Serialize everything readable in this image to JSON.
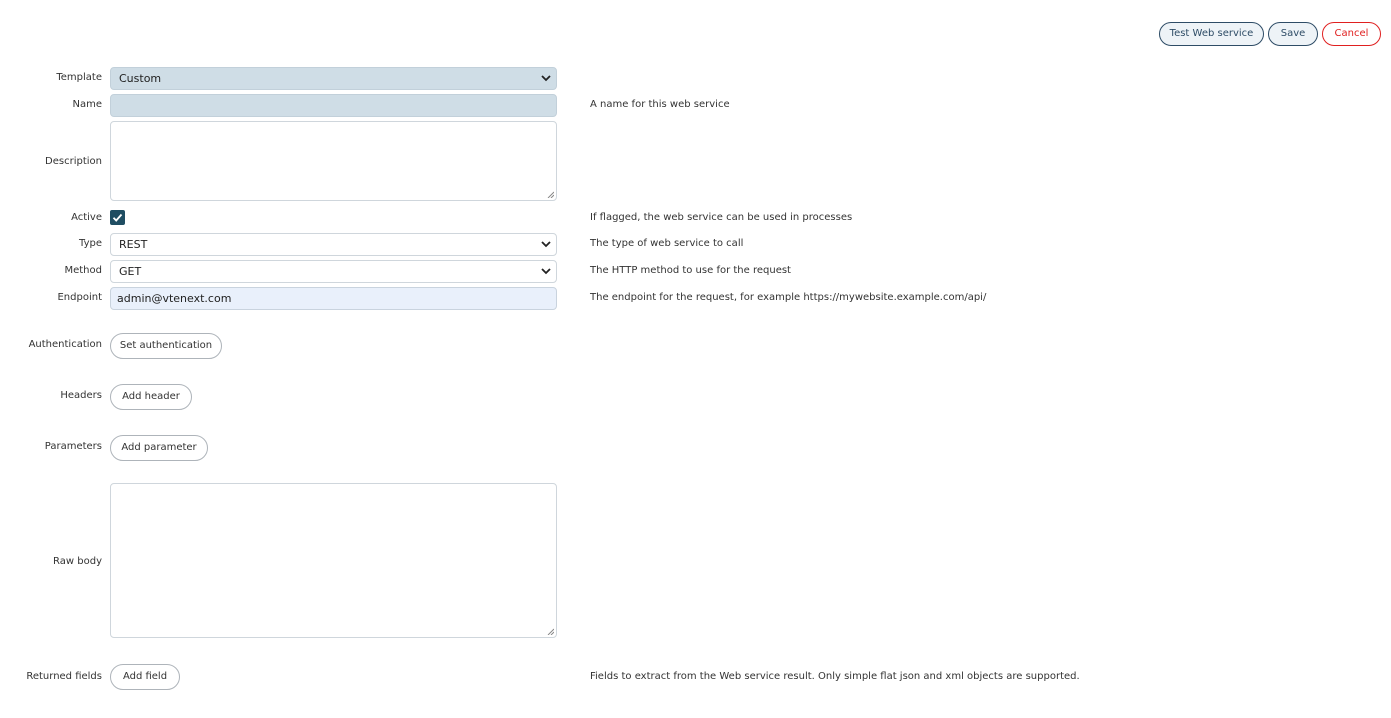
{
  "toolbar": {
    "test_label": "Test Web service",
    "save_label": "Save",
    "cancel_label": "Cancel"
  },
  "form": {
    "template": {
      "label": "Template",
      "value": "Custom"
    },
    "name": {
      "label": "Name",
      "value": "",
      "help": "A name for this web service"
    },
    "description": {
      "label": "Description",
      "value": ""
    },
    "active": {
      "label": "Active",
      "checked": true,
      "help": "If flagged, the web service can be used in processes"
    },
    "type": {
      "label": "Type",
      "value": "REST",
      "help": "The type of web service to call"
    },
    "method": {
      "label": "Method",
      "value": "GET",
      "help": "The HTTP method to use for the request"
    },
    "endpoint": {
      "label": "Endpoint",
      "value": "admin@vtenext.com",
      "help": "The endpoint for the request, for example https://mywebsite.example.com/api/"
    },
    "authentication": {
      "label": "Authentication",
      "button": "Set authentication"
    },
    "headers": {
      "label": "Headers",
      "button": "Add header"
    },
    "parameters": {
      "label": "Parameters",
      "button": "Add parameter"
    },
    "raw_body": {
      "label": "Raw body",
      "value": ""
    },
    "returned_fields": {
      "label": "Returned fields",
      "button": "Add field",
      "help": "Fields to extract from the Web service result. Only simple flat json and xml objects are supported."
    }
  },
  "colors": {
    "accent": "#2e4c66",
    "danger": "#e02020",
    "checkbox": "#1f4d62",
    "filled_field": "#cfdde6",
    "endpoint_field": "#e9f0fb"
  },
  "icons": {
    "select_arrow": "chevron-down-icon",
    "checkbox_mark": "check-icon",
    "textarea_resize": "resize-grip-icon"
  }
}
